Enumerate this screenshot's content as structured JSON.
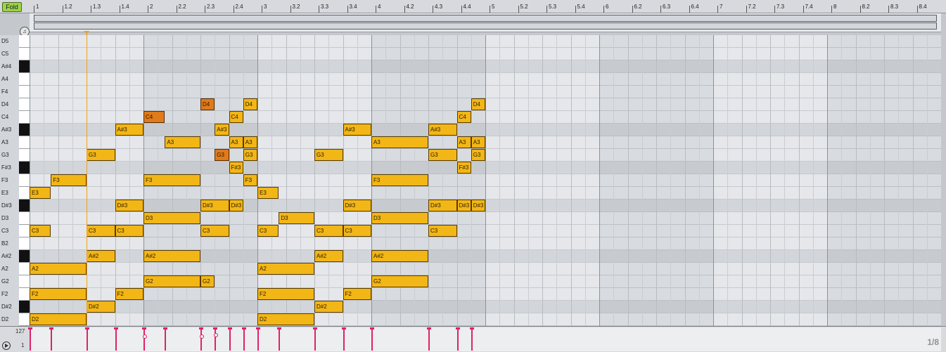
{
  "toolbar": {
    "fold_label": "Fold",
    "headphone_icon": "headphone-icon",
    "play_icon": "play-circle-icon"
  },
  "ruler": {
    "labels": [
      "1",
      "1.2",
      "1.3",
      "1.4",
      "2",
      "2.2",
      "2.3",
      "2.4",
      "3",
      "3.2",
      "3.3",
      "3.4",
      "4",
      "4.2",
      "4.3",
      "4.4",
      "5",
      "5.2",
      "5.3",
      "5.4",
      "6",
      "6.2",
      "6.3",
      "6.4",
      "7",
      "7.2",
      "7.3",
      "7.4",
      "8",
      "8.2",
      "8.3",
      "8.4"
    ]
  },
  "keys": [
    {
      "label": "D5",
      "black": false
    },
    {
      "label": "C5",
      "black": false
    },
    {
      "label": "A#4",
      "black": true
    },
    {
      "label": "A4",
      "black": false
    },
    {
      "label": "F4",
      "black": false
    },
    {
      "label": "D4",
      "black": false
    },
    {
      "label": "C4",
      "black": false
    },
    {
      "label": "A#3",
      "black": true
    },
    {
      "label": "A3",
      "black": false
    },
    {
      "label": "G3",
      "black": false
    },
    {
      "label": "F#3",
      "black": true
    },
    {
      "label": "F3",
      "black": false
    },
    {
      "label": "E3",
      "black": false
    },
    {
      "label": "D#3",
      "black": true
    },
    {
      "label": "D3",
      "black": false
    },
    {
      "label": "C3",
      "black": false
    },
    {
      "label": "B2",
      "black": false
    },
    {
      "label": "A#2",
      "black": true
    },
    {
      "label": "A2",
      "black": false
    },
    {
      "label": "G2",
      "black": false
    },
    {
      "label": "F2",
      "black": false
    },
    {
      "label": "D#2",
      "black": true
    },
    {
      "label": "D2",
      "black": false
    }
  ],
  "notes": [
    {
      "pitch": "E3",
      "start": 0,
      "len": 0.75
    },
    {
      "pitch": "C3",
      "start": 0,
      "len": 0.75
    },
    {
      "pitch": "A2",
      "start": 0,
      "len": 2
    },
    {
      "pitch": "F2",
      "start": 0,
      "len": 2
    },
    {
      "pitch": "D2",
      "start": 0,
      "len": 2
    },
    {
      "pitch": "F3",
      "start": 0.75,
      "len": 1.25
    },
    {
      "pitch": "G3",
      "start": 2,
      "len": 1
    },
    {
      "pitch": "C3",
      "start": 2,
      "len": 1
    },
    {
      "pitch": "A#2",
      "start": 2,
      "len": 1
    },
    {
      "pitch": "D#2",
      "start": 2,
      "len": 1
    },
    {
      "pitch": "A#3",
      "start": 3,
      "len": 1
    },
    {
      "pitch": "D#3",
      "start": 3,
      "len": 1
    },
    {
      "pitch": "C3",
      "start": 3,
      "len": 1
    },
    {
      "pitch": "F2",
      "start": 3,
      "len": 1
    },
    {
      "pitch": "C4",
      "start": 4,
      "len": 0.75,
      "selected": true
    },
    {
      "pitch": "F3",
      "start": 4,
      "len": 2
    },
    {
      "pitch": "D3",
      "start": 4,
      "len": 2
    },
    {
      "pitch": "A#2",
      "start": 4,
      "len": 2
    },
    {
      "pitch": "G2",
      "start": 4,
      "len": 2
    },
    {
      "pitch": "A3",
      "start": 4.75,
      "len": 1.25
    },
    {
      "pitch": "D4",
      "start": 6,
      "len": 0.5,
      "selected": true
    },
    {
      "pitch": "D#3",
      "start": 6,
      "len": 1
    },
    {
      "pitch": "C3",
      "start": 6,
      "len": 1
    },
    {
      "pitch": "G2",
      "start": 6,
      "len": 0.5
    },
    {
      "pitch": "A#3",
      "start": 6.5,
      "len": 0.5
    },
    {
      "pitch": "G3",
      "start": 6.5,
      "len": 0.5,
      "selected": true
    },
    {
      "pitch": "C4",
      "start": 7,
      "len": 0.5
    },
    {
      "pitch": "A3",
      "start": 7,
      "len": 0.5
    },
    {
      "pitch": "F#3",
      "start": 7,
      "len": 0.5
    },
    {
      "pitch": "D#3",
      "start": 7,
      "len": 0.5
    },
    {
      "pitch": "D4",
      "start": 7.5,
      "len": 0.5
    },
    {
      "pitch": "A3",
      "start": 7.5,
      "len": 0.5
    },
    {
      "pitch": "G3",
      "start": 7.5,
      "len": 0.5
    },
    {
      "pitch": "F3",
      "start": 7.5,
      "len": 0.5
    },
    {
      "pitch": "E3",
      "start": 8,
      "len": 0.75
    },
    {
      "pitch": "C3",
      "start": 8,
      "len": 0.75
    },
    {
      "pitch": "A2",
      "start": 8,
      "len": 2
    },
    {
      "pitch": "F2",
      "start": 8,
      "len": 2
    },
    {
      "pitch": "D2",
      "start": 8,
      "len": 2
    },
    {
      "pitch": "D3",
      "start": 8.75,
      "len": 1.25
    },
    {
      "pitch": "G3",
      "start": 10,
      "len": 1
    },
    {
      "pitch": "C3",
      "start": 10,
      "len": 1
    },
    {
      "pitch": "A#2",
      "start": 10,
      "len": 1
    },
    {
      "pitch": "D#2",
      "start": 10,
      "len": 1
    },
    {
      "pitch": "A#3",
      "start": 11,
      "len": 1
    },
    {
      "pitch": "D#3",
      "start": 11,
      "len": 1
    },
    {
      "pitch": "C3",
      "start": 11,
      "len": 1
    },
    {
      "pitch": "F2",
      "start": 11,
      "len": 1
    },
    {
      "pitch": "A3",
      "start": 12,
      "len": 2
    },
    {
      "pitch": "F3",
      "start": 12,
      "len": 2
    },
    {
      "pitch": "D3",
      "start": 12,
      "len": 2
    },
    {
      "pitch": "A#2",
      "start": 12,
      "len": 2
    },
    {
      "pitch": "G2",
      "start": 12,
      "len": 2
    },
    {
      "pitch": "A#3",
      "start": 14,
      "len": 1
    },
    {
      "pitch": "G3",
      "start": 14,
      "len": 1
    },
    {
      "pitch": "D#3",
      "start": 14,
      "len": 1
    },
    {
      "pitch": "C3",
      "start": 14,
      "len": 1
    },
    {
      "pitch": "C4",
      "start": 15,
      "len": 0.5
    },
    {
      "pitch": "A3",
      "start": 15,
      "len": 0.5
    },
    {
      "pitch": "F#3",
      "start": 15,
      "len": 0.5
    },
    {
      "pitch": "D#3",
      "start": 15,
      "len": 0.5
    },
    {
      "pitch": "D4",
      "start": 15.5,
      "len": 0.5
    },
    {
      "pitch": "A3",
      "start": 15.5,
      "len": 0.5
    },
    {
      "pitch": "G3",
      "start": 15.5,
      "len": 0.5
    },
    {
      "pitch": "D#3",
      "start": 15.5,
      "len": 0.5
    }
  ],
  "velocity": {
    "max_label": "127",
    "min_label": "1"
  },
  "page_indicator": "1/8",
  "colors": {
    "note": "#f2b616",
    "note_selected": "#e07a1a",
    "velocity": "#e0216a",
    "playhead": "#f0a020"
  }
}
